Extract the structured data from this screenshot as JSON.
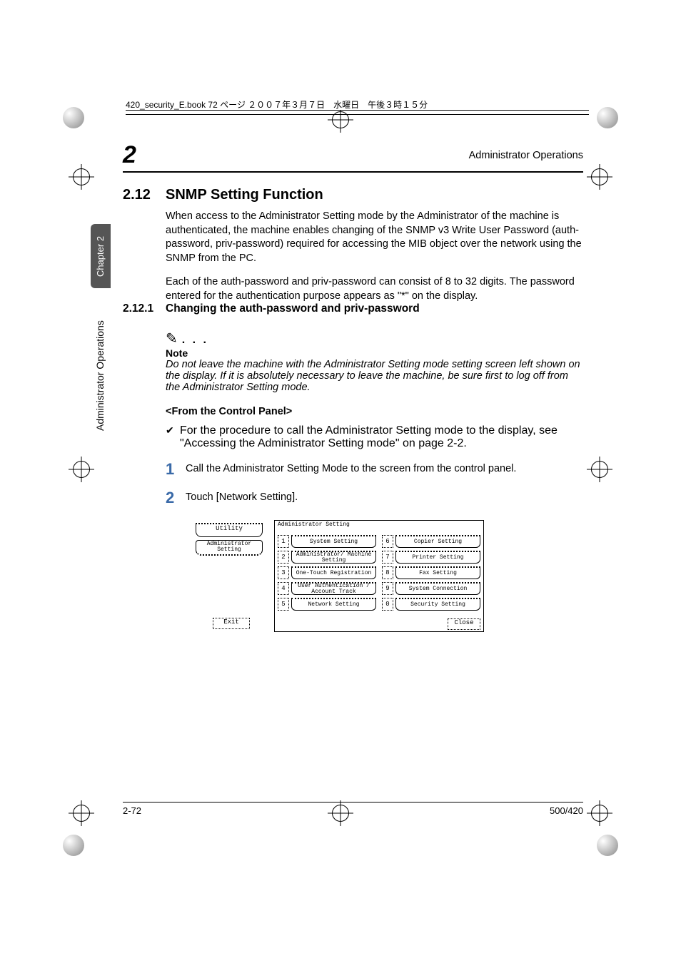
{
  "meta": {
    "header_line": "420_security_E.book  72 ページ  ２００７年３月７日　水曜日　午後３時１５分",
    "right_header": "Administrator Operations",
    "chapter_badge": "Chapter 2",
    "side_label": "Administrator Operations",
    "big_num": "2",
    "page_left": "2-72",
    "page_right": "500/420"
  },
  "sec": {
    "num": "2.12",
    "title": "SNMP Setting Function",
    "para1": "When access to the Administrator Setting mode by the Administrator of the machine is authenticated, the machine enables changing of the SNMP v3 Write User Password (auth-password, priv-password) required for accessing the MIB object over the network using the SNMP from the PC.",
    "para2": "Each of the auth-password and priv-password can consist of 8 to 32 digits. The password entered for the authentication purpose appears as \"*\" on the display."
  },
  "sub": {
    "num": "2.12.1",
    "title": "Changing the auth-password and priv-password",
    "note_label": "Note",
    "note_body": "Do not leave the machine with the Administrator Setting mode setting screen left shown on the display. If it is absolutely necessary to leave the machine, be sure first to log off from the Administrator Setting mode.",
    "from_panel": "<From the Control Panel>",
    "check_text": "For the procedure to call the Administrator Setting mode to the display, see \"Accessing the Administrator Setting mode\" on page 2-2.",
    "step1_num": "1",
    "step1_text": "Call the Administrator Setting Mode to the screen from the control panel.",
    "step2_num": "2",
    "step2_text": "Touch [Network Setting]."
  },
  "panel": {
    "utility": "Utility",
    "admin_setting": "Administrator Setting",
    "exit": "Exit",
    "title": "Administrator Setting",
    "close": "Close",
    "left_col": [
      {
        "n": "1",
        "label": "System Setting"
      },
      {
        "n": "2",
        "label": "Administrator/ Machine Setting"
      },
      {
        "n": "3",
        "label": "One-Touch Registration"
      },
      {
        "n": "4",
        "label": "User Authentication / Account Track"
      },
      {
        "n": "5",
        "label": "Network Setting"
      }
    ],
    "right_col": [
      {
        "n": "6",
        "label": "Copier Setting"
      },
      {
        "n": "7",
        "label": "Printer Setting"
      },
      {
        "n": "8",
        "label": "Fax Setting"
      },
      {
        "n": "9",
        "label": "System Connection"
      },
      {
        "n": "0",
        "label": "Security Setting"
      }
    ]
  }
}
